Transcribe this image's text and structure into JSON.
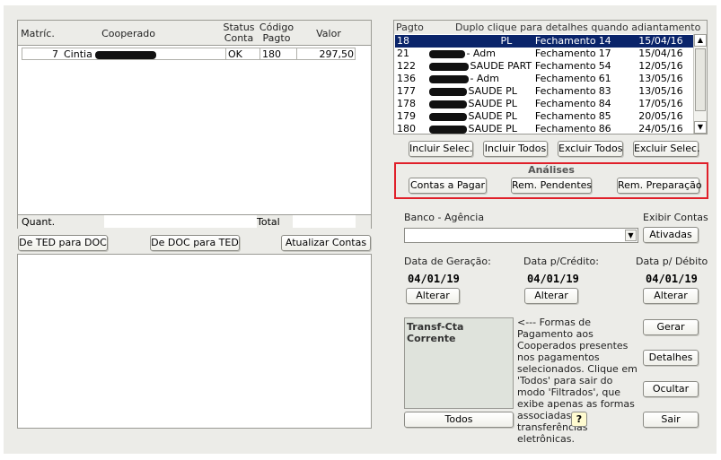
{
  "left_table": {
    "headers": {
      "matric": "Matríc.",
      "cooperado": "Cooperado",
      "status": "Status\nConta",
      "codigo": "Código\nPagto",
      "valor": "Valor"
    },
    "rows": [
      {
        "matric": "7",
        "name": "Cintia",
        "status": "OK",
        "codigo": "180",
        "valor": "297,50"
      }
    ],
    "footer_quant": "Quant.",
    "footer_total": "Total"
  },
  "left_buttons": {
    "ted_doc": "De TED para DOC",
    "doc_ted": "De DOC para TED",
    "atualizar": "Atualizar Contas"
  },
  "right_list": {
    "header_pagto": "Pagto",
    "header_hint": "Duplo clique para detalhes quando adiantamento",
    "rows": [
      {
        "pagto": "18",
        "name": "PL",
        "tipo": "Fechamento",
        "num": "14",
        "data": "15/04/16",
        "selected": true
      },
      {
        "pagto": "21",
        "name": "- Adm",
        "tipo": "Fechamento",
        "num": "17",
        "data": "15/04/16"
      },
      {
        "pagto": "122",
        "name": "SAUDE PART",
        "tipo": "Fechamento",
        "num": "54",
        "data": "12/05/16"
      },
      {
        "pagto": "136",
        "name": "- Adm",
        "tipo": "Fechamento",
        "num": "61",
        "data": "13/05/16"
      },
      {
        "pagto": "177",
        "name": "SAUDE PL",
        "tipo": "Fechamento",
        "num": "83",
        "data": "13/05/16"
      },
      {
        "pagto": "178",
        "name": "SAUDE PL",
        "tipo": "Fechamento",
        "num": "84",
        "data": "17/05/16"
      },
      {
        "pagto": "179",
        "name": "SAUDE PL",
        "tipo": "Fechamento",
        "num": "85",
        "data": "20/05/16"
      },
      {
        "pagto": "180",
        "name": "SAUDE PL",
        "tipo": "Fechamento",
        "num": "86",
        "data": "24/05/16"
      }
    ]
  },
  "list_buttons": {
    "incluir_sel": "Incluir Selec.",
    "incluir_todos": "Incluir Todos",
    "excluir_todos": "Excluir Todos",
    "excluir_sel": "Excluir Selec."
  },
  "analises": {
    "title": "Análises",
    "contas": "Contas a Pagar",
    "pendentes": "Rem. Pendentes",
    "preparacao": "Rem.  Preparação"
  },
  "banco": {
    "label": "Banco - Agência",
    "exibir_label": "Exibir Contas",
    "ativadas": "Ativadas"
  },
  "dates": {
    "geracao_label": "Data de Geração:",
    "geracao": "04/01/19",
    "credito_label": "Data p/Crédito:",
    "credito": "04/01/19",
    "debito_label": "Data p/ Débito",
    "debito": "04/01/19",
    "alterar": "Alterar"
  },
  "formas": {
    "box_title": "Transf-Cta Corrente",
    "todos": "Todos",
    "info": "<--- Formas de Pagamento aos Cooperados presentes nos pagamentos selecionados. Clique em 'Todos' para sair do modo 'Filtrados', que exibe apenas as formas associadas a transferências eletrônicas.",
    "help": "?"
  },
  "actions": {
    "gerar": "Gerar",
    "detalhes": "Detalhes",
    "ocultar": "Ocultar",
    "sair": "Sair"
  },
  "colors": {
    "panel": "#ecece8",
    "selected_row": "#0a246a",
    "red_frame": "#e0202a"
  }
}
